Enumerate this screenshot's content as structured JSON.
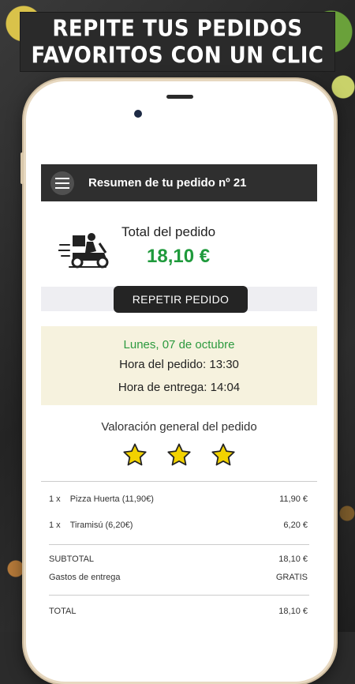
{
  "banner": {
    "line1": "REPITE TUS PEDIDOS",
    "line2": "FAVORITOS CON UN CLIC"
  },
  "appbar": {
    "menu_icon": "hamburger-menu-icon",
    "title": "Resumen de tu pedido nº 21"
  },
  "summary": {
    "icon": "delivery-scooter-icon",
    "total_label": "Total del pedido",
    "total_value": "18,10 €",
    "total_color": "#1f9a3c"
  },
  "repeat_button": {
    "label": "REPETIR PEDIDO"
  },
  "dates": {
    "date": "Lunes, 07 de octubre",
    "order_time": "Hora del pedido: 13:30",
    "delivery_time": "Hora de entrega: 14:04"
  },
  "rating": {
    "title": "Valoración general del pedido",
    "stars": 3,
    "max_stars": 3,
    "star_color": "#f2d200"
  },
  "items": [
    {
      "qty": "1 x",
      "name": "Pizza Huerta (11,90€)",
      "price": "11,90 €"
    },
    {
      "qty": "1 x",
      "name": "Tiramisú (6,20€)",
      "price": "6,20 €"
    }
  ],
  "totals": {
    "subtotal_label": "SUBTOTAL",
    "subtotal_value": "18,10 €",
    "delivery_label": "Gastos de entrega",
    "delivery_value": "GRATIS",
    "total_label": "TOTAL",
    "total_value": "18,10 €"
  }
}
